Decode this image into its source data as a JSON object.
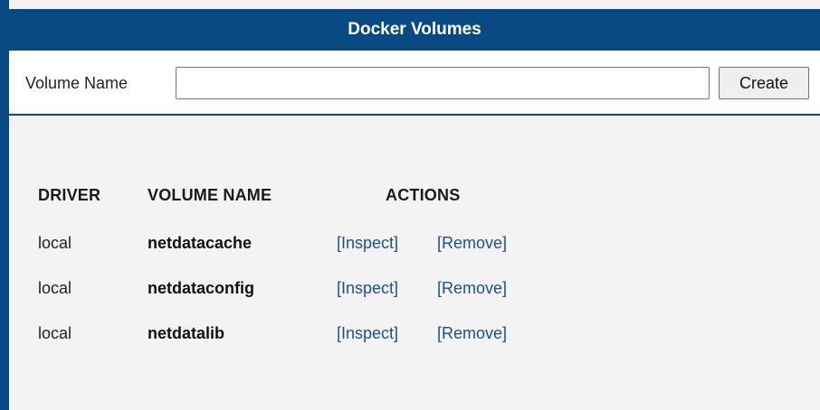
{
  "header": {
    "title": "Docker Volumes"
  },
  "create_form": {
    "label": "Volume Name",
    "input_value": "",
    "input_placeholder": "",
    "button_label": "Create"
  },
  "table": {
    "columns": [
      "DRIVER",
      "VOLUME NAME",
      "ACTIONS"
    ],
    "rows": [
      {
        "driver": "local",
        "name": "netdatacache",
        "inspect": "[Inspect]",
        "remove": "[Remove]"
      },
      {
        "driver": "local",
        "name": "netdataconfig",
        "inspect": "[Inspect]",
        "remove": "[Remove]"
      },
      {
        "driver": "local",
        "name": "netdatalib",
        "inspect": "[Inspect]",
        "remove": "[Remove]"
      }
    ]
  },
  "colors": {
    "header_background": "#0a4a83",
    "header_text": "#ffffff",
    "link": "#1f4e8c",
    "page_background": "#f3f3f3"
  }
}
